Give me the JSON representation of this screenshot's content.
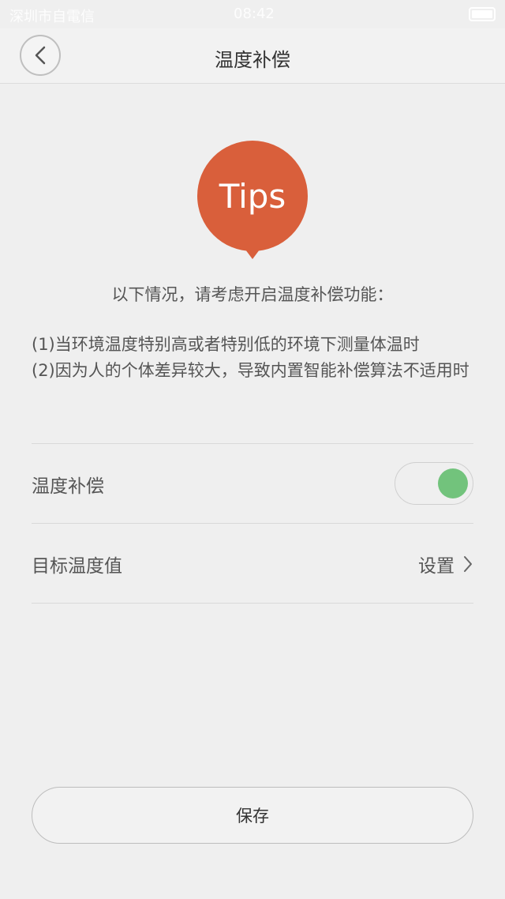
{
  "status_bar": {
    "carrier": "深圳市自電信",
    "time": "08:42"
  },
  "header": {
    "title": "温度补偿",
    "back_icon": "chevron-left-icon"
  },
  "tips": {
    "badge_text": "Tips",
    "badge_color": "#d95f3b",
    "intro": "以下情况，请考虑开启温度补偿功能：",
    "notes": [
      "(1)当环境温度特别高或者特别低的环境下测量体温时",
      "(2)因为人的个体差异较大，导致内置智能补偿算法不适用时"
    ]
  },
  "settings": {
    "compensation": {
      "label": "温度补偿",
      "enabled": true,
      "on_color": "#72c37c"
    },
    "target_temperature": {
      "label": "目标温度值",
      "action_label": "设置",
      "action_icon": "chevron-right-icon"
    }
  },
  "footer": {
    "save_label": "保存"
  }
}
